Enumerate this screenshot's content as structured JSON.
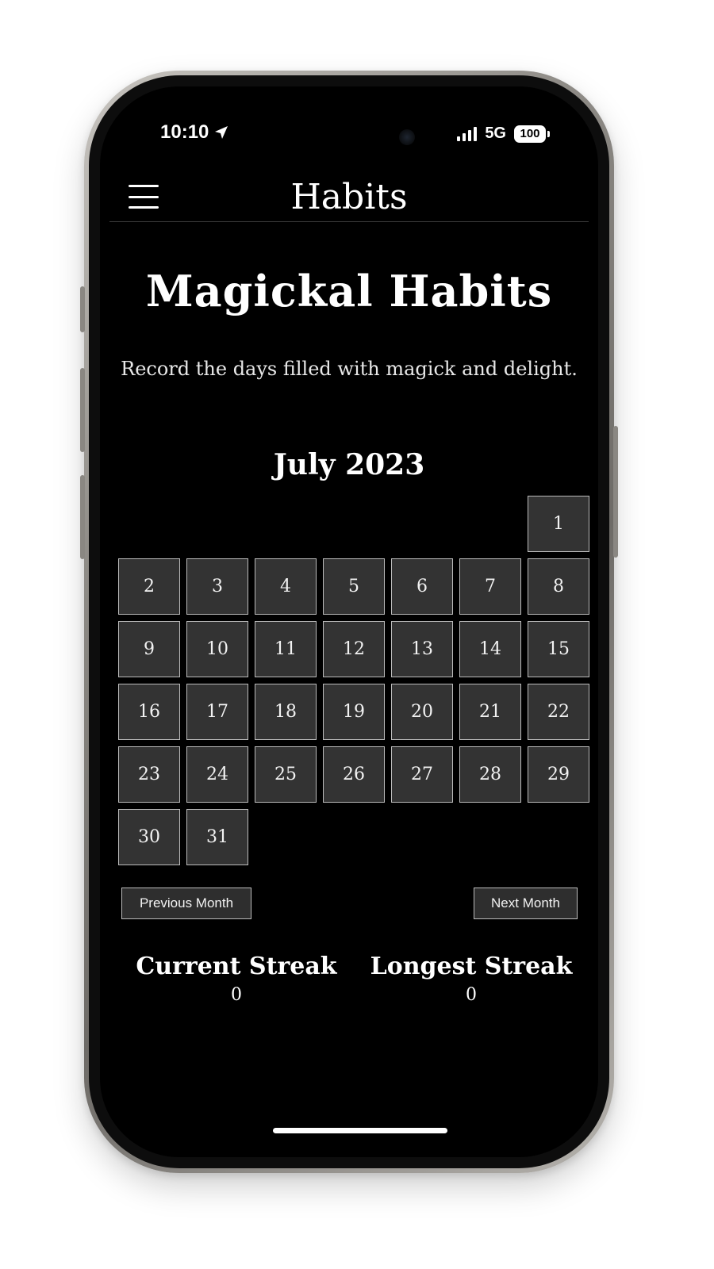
{
  "status_bar": {
    "time": "10:10",
    "network": "5G",
    "battery": "100"
  },
  "header": {
    "title": "Habits"
  },
  "page": {
    "title": "Magickal Habits",
    "subtitle": "Record the days filled with magick and delight."
  },
  "calendar": {
    "month_label": "July 2023",
    "leading_empty_days": 6,
    "days": [
      "1",
      "2",
      "3",
      "4",
      "5",
      "6",
      "7",
      "8",
      "9",
      "10",
      "11",
      "12",
      "13",
      "14",
      "15",
      "16",
      "17",
      "18",
      "19",
      "20",
      "21",
      "22",
      "23",
      "24",
      "25",
      "26",
      "27",
      "28",
      "29",
      "30",
      "31"
    ]
  },
  "navigation": {
    "previous_label": "Previous Month",
    "next_label": "Next Month"
  },
  "streaks": {
    "current_label": "Current Streak",
    "current_value": "0",
    "longest_label": "Longest Streak",
    "longest_value": "0"
  },
  "colors": {
    "background": "#000000",
    "cell_fill": "#333333",
    "cell_border": "#bcbcbc",
    "text": "#ffffff"
  }
}
